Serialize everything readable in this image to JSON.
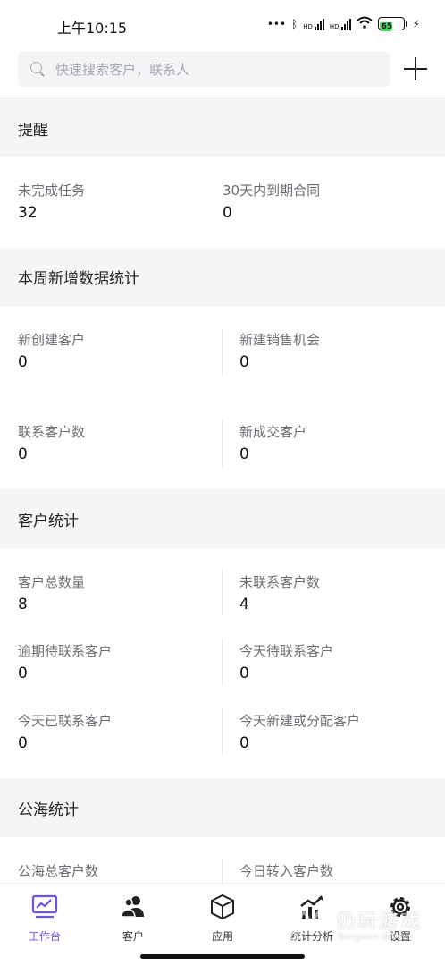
{
  "status_bar": {
    "time": "上午10:15",
    "battery": "65",
    "net_label_1": "HD",
    "net_label_2": "HD"
  },
  "search": {
    "placeholder": "快速搜索客户，联系人"
  },
  "sections": {
    "reminders": {
      "title": "提醒",
      "items": [
        {
          "label": "未完成任务",
          "value": "32"
        },
        {
          "label": "30天内到期合同",
          "value": "0"
        }
      ]
    },
    "weekly": {
      "title": "本周新增数据统计",
      "items": [
        {
          "label": "新创建客户",
          "value": "0"
        },
        {
          "label": "新建销售机会",
          "value": "0"
        },
        {
          "label": "联系客户数",
          "value": "0"
        },
        {
          "label": "新成交客户",
          "value": "0"
        }
      ]
    },
    "customer_stats": {
      "title": "客户统计",
      "items": [
        {
          "label": "客户总数量",
          "value": "8"
        },
        {
          "label": "未联系客户数",
          "value": "4"
        },
        {
          "label": "逾期待联系客户",
          "value": "0"
        },
        {
          "label": "今天待联系客户",
          "value": "0"
        },
        {
          "label": "今天已联系客户",
          "value": "0"
        },
        {
          "label": "今天新建或分配客户",
          "value": "0"
        }
      ]
    },
    "public_pool": {
      "title": "公海统计",
      "items": [
        {
          "label": "公海总客户数"
        },
        {
          "label": "今日转入客户数"
        }
      ]
    }
  },
  "tabs": [
    {
      "label": "工作台",
      "icon": "workbench-icon",
      "active": true
    },
    {
      "label": "客户",
      "icon": "customers-icon"
    },
    {
      "label": "应用",
      "icon": "apps-cube-icon"
    },
    {
      "label": "统计分析",
      "icon": "analytics-icon"
    },
    {
      "label": "设置",
      "icon": "settings-gear-icon"
    }
  ],
  "watermark": {
    "text": "仍玩游戏",
    "sub": "Rengwan Games"
  },
  "colors": {
    "accent": "#6b54e6",
    "section_bg": "#f4f5f7",
    "label": "#6b6e73"
  }
}
